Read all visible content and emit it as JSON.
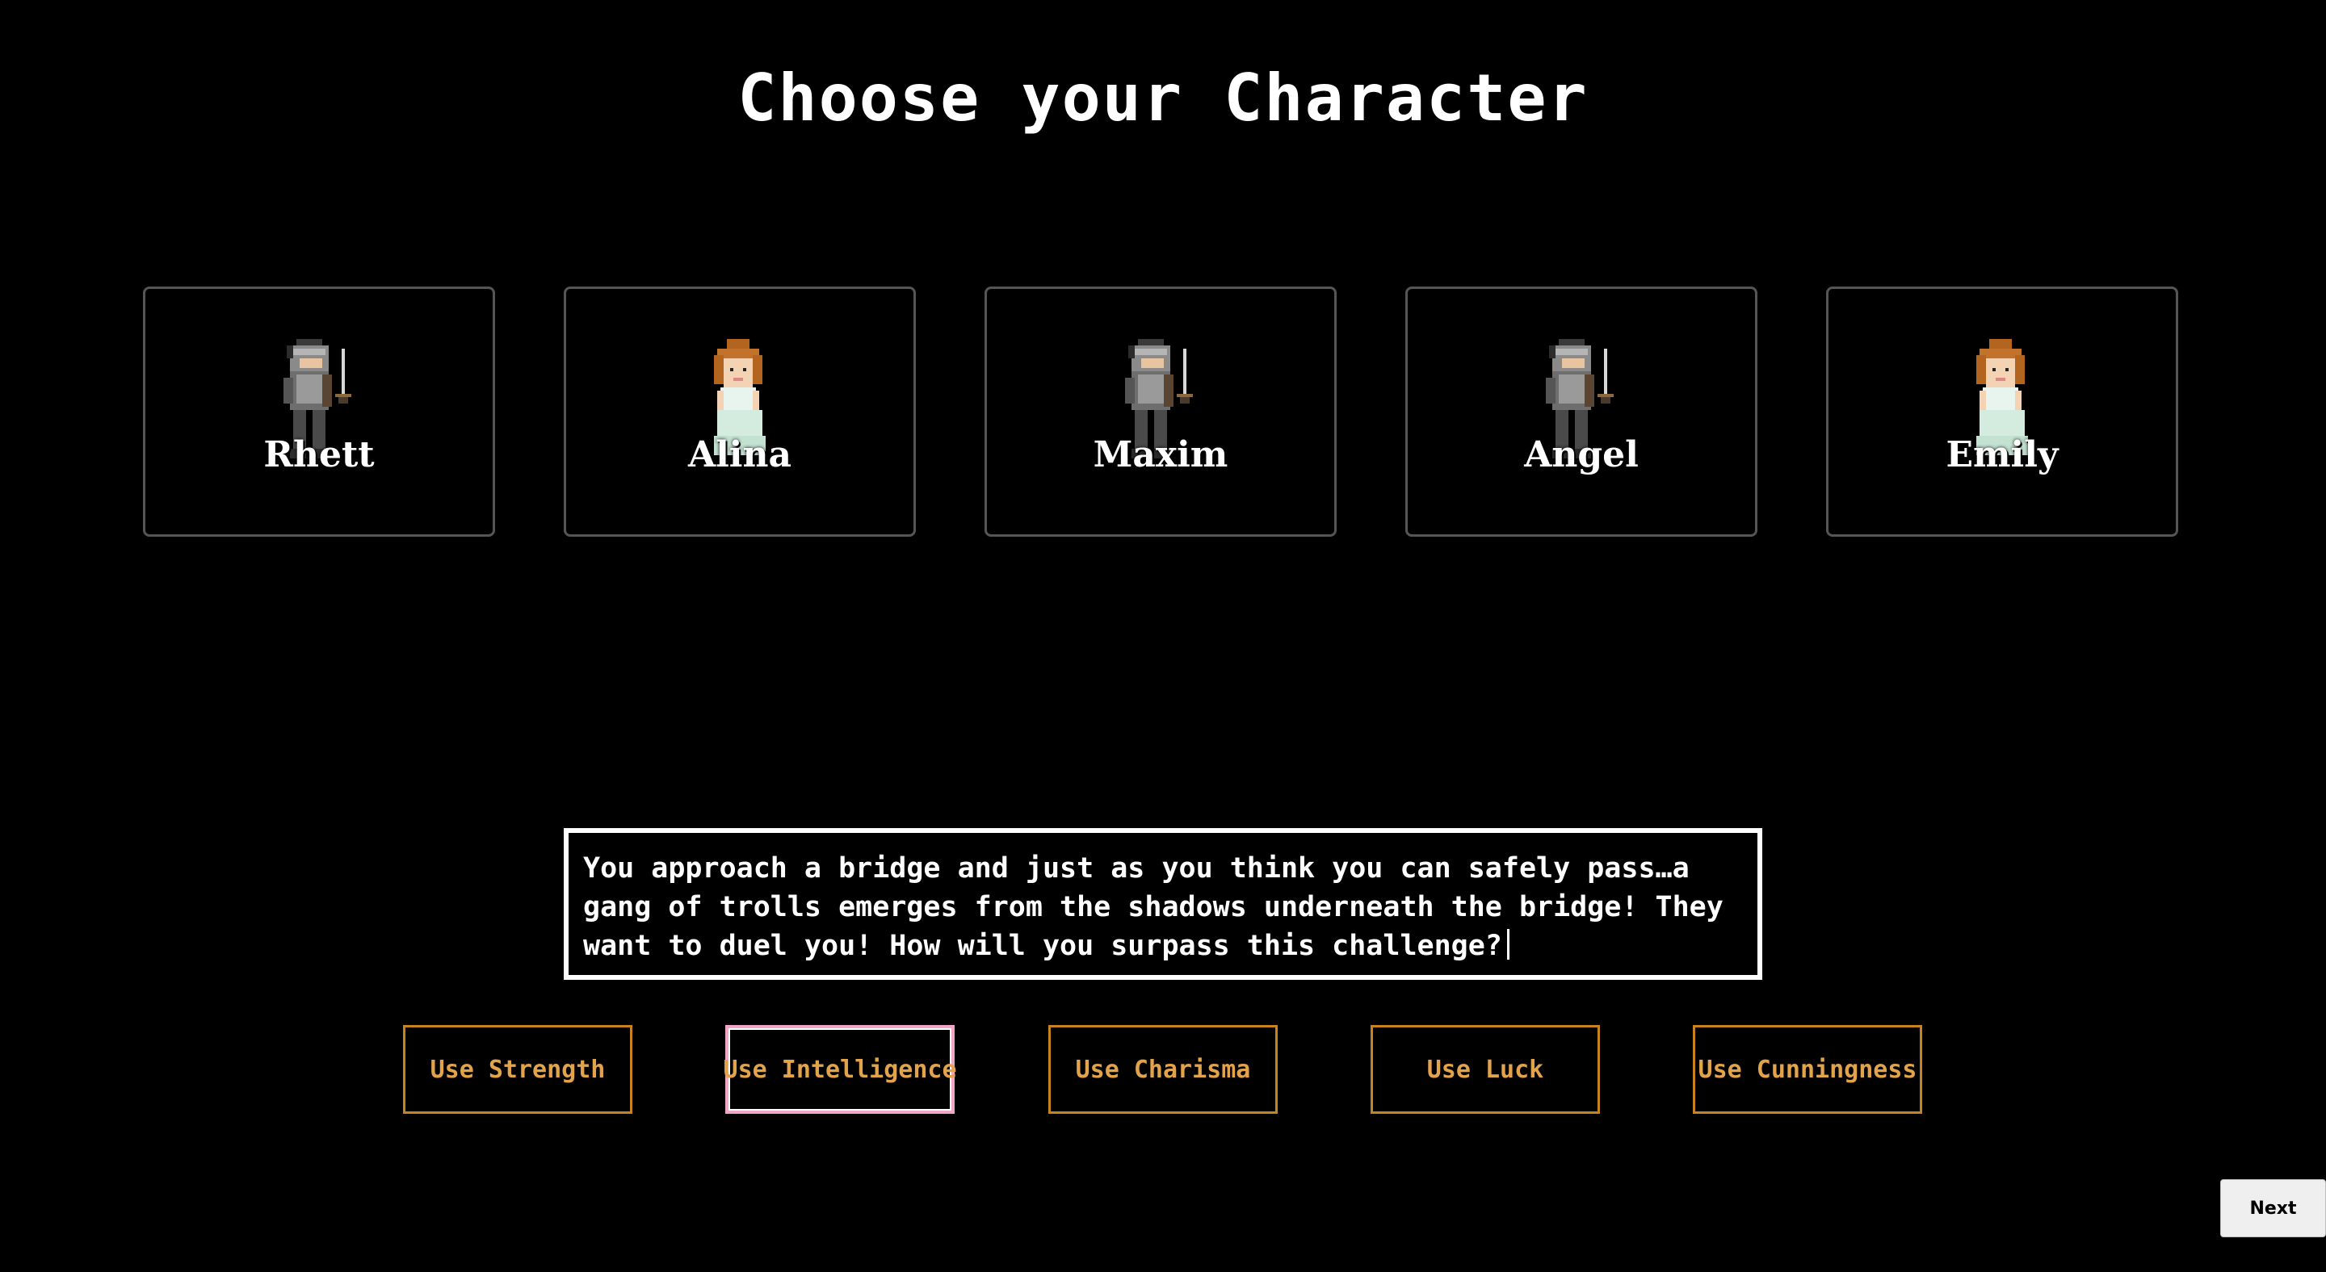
{
  "page": {
    "title": "Choose your Character"
  },
  "characters": [
    {
      "name": "Rhett",
      "sprite": "knight-sprite-icon"
    },
    {
      "name": "Alina",
      "sprite": "princess-sprite-icon"
    },
    {
      "name": "Maxim",
      "sprite": "knight-sprite-icon"
    },
    {
      "name": "Angel",
      "sprite": "knight-sprite-icon"
    },
    {
      "name": "Emily",
      "sprite": "princess-sprite-icon"
    }
  ],
  "story": {
    "text": "You approach a bridge and just as you think you can safely pass…a gang of trolls emerges from the shadows underneath the bridge! They want to duel you! How will you surpass this challenge?"
  },
  "actions": [
    {
      "label": "Use Strength",
      "selected": false
    },
    {
      "label": "Use Intelligence",
      "selected": true
    },
    {
      "label": "Use Charisma",
      "selected": false
    },
    {
      "label": "Use Luck",
      "selected": false
    },
    {
      "label": "Use Cunningness",
      "selected": false
    }
  ],
  "footer": {
    "next_label": "Next"
  },
  "colors": {
    "background": "#000000",
    "action_border": "#c8821e",
    "action_text": "#e3a34a",
    "selected_border": "#f2a6c6",
    "card_border": "#555555"
  }
}
